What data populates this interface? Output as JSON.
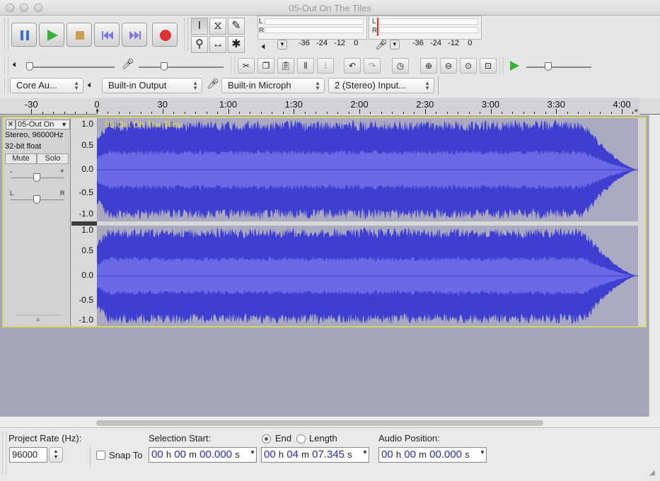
{
  "window": {
    "title": "05-Out On The Tiles"
  },
  "meters": {
    "playback_label": "L R",
    "record_label": "L R",
    "scale": [
      "-36",
      "-24",
      "-12",
      "0"
    ]
  },
  "device_bar": {
    "host": "Core Au...",
    "output": "Built-in Output",
    "input": "Built-in Microph",
    "channels": "2 (Stereo) Input..."
  },
  "ruler": {
    "ticks": [
      {
        "label": "-30",
        "t": -30
      },
      {
        "label": "0",
        "t": 0
      },
      {
        "label": "30",
        "t": 30
      },
      {
        "label": "1:00",
        "t": 60
      },
      {
        "label": "1:30",
        "t": 90
      },
      {
        "label": "2:00",
        "t": 120
      },
      {
        "label": "2:30",
        "t": 150
      },
      {
        "label": "3:00",
        "t": 180
      },
      {
        "label": "3:30",
        "t": 210
      },
      {
        "label": "4:00",
        "t": 240
      }
    ]
  },
  "track": {
    "name": "05-Out On",
    "clip_name": "05-Out On The Tiles",
    "format": "Stereo, 96000Hz",
    "bits": "32-bit float",
    "mute": "Mute",
    "solo": "Solo",
    "pan_left": "L",
    "pan_right": "R",
    "gain_minus": "-",
    "gain_plus": "+",
    "vscale": [
      "1.0",
      "0.5",
      "0.0",
      "-0.5",
      "-1.0"
    ],
    "duration_seconds": 247.345
  },
  "selection": {
    "project_rate_label": "Project Rate (Hz):",
    "project_rate": "96000",
    "snap_label": "Snap To",
    "start_label": "Selection Start:",
    "end_label": "End",
    "length_label": "Length",
    "audio_pos_label": "Audio Position:",
    "start": {
      "h": "00",
      "m": "00",
      "s": "00.000"
    },
    "end": {
      "h": "00",
      "m": "04",
      "s": "07.345"
    },
    "position": {
      "h": "00",
      "m": "00",
      "s": "00.000"
    },
    "unit_h": "h",
    "unit_m": "m",
    "unit_s": "s"
  },
  "colors": {
    "wave": "#3e3ed0",
    "wave_rms": "#6a6ae6",
    "wave_bg": "#a9a9c2",
    "track_border": "#d6d36a"
  }
}
